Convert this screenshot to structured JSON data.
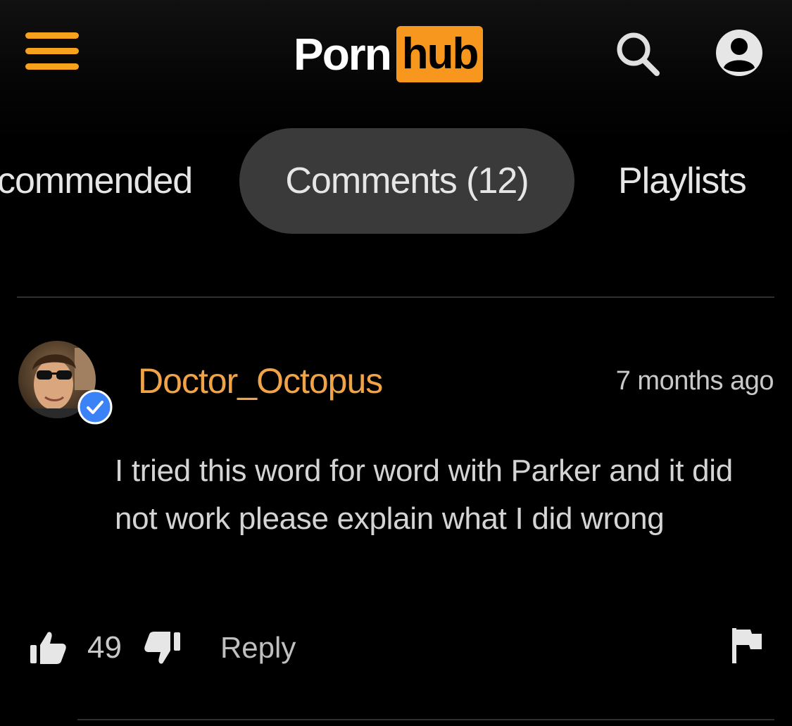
{
  "header": {
    "menu_icon": "hamburger-menu-icon",
    "logo_left": "Porn",
    "logo_right": "hub",
    "search_icon": "search-icon",
    "account_icon": "account-icon",
    "accent_color": "#f7971d"
  },
  "tabs": [
    {
      "label": "commended"
    },
    {
      "label": "Comments (12)",
      "active": true
    },
    {
      "label": "Playlists"
    }
  ],
  "comment": {
    "username": "Doctor_Octopus",
    "verified": true,
    "timestamp": "7 months ago",
    "text": "I tried this word for word with Parker and it did not work please explain what I did wrong",
    "likes": "49",
    "reply_label": "Reply",
    "username_color": "#f0a347",
    "verified_color": "#3b82f6"
  }
}
